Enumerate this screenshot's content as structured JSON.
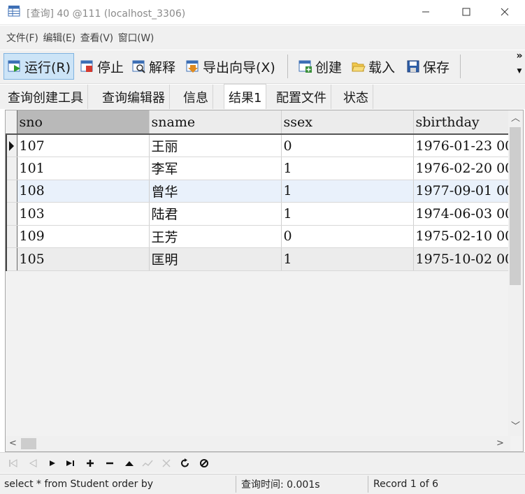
{
  "window": {
    "title": "[查询] 40 @111 (localhost_3306)",
    "icon": "db-table-icon"
  },
  "menu": [
    "文件(F)",
    "编辑(E)",
    "查看(V)",
    "窗口(W)"
  ],
  "toolbar": {
    "run": "运行(R)",
    "stop": "停止",
    "explain": "解释",
    "export": "导出向导(X)",
    "create": "创建",
    "load": "载入",
    "save": "保存",
    "overflow": "»"
  },
  "tabs": [
    "查询创建工具",
    "查询编辑器",
    "信息",
    "结果1",
    "配置文件",
    "状态"
  ],
  "active_tab_index": 3,
  "grid": {
    "columns": [
      "sno",
      "sname",
      "ssex",
      "sbirthday"
    ],
    "rows": [
      [
        "107",
        "王丽",
        "0",
        "1976-01-23 00"
      ],
      [
        "101",
        "李军",
        "1",
        "1976-02-20 00"
      ],
      [
        "108",
        "曾华",
        "1",
        "1977-09-01 00"
      ],
      [
        "103",
        "陆君",
        "1",
        "1974-06-03 00"
      ],
      [
        "109",
        "王芳",
        "0",
        "1975-02-10 00"
      ],
      [
        "105",
        "匡明",
        "1",
        "1975-10-02 00"
      ]
    ],
    "current_row_index": 0
  },
  "status": {
    "sql": "select * from Student order by",
    "query_time": "查询时间: 0.001s",
    "record": "Record 1 of 6"
  },
  "colors": {
    "active_button_bg": "#cce4f7",
    "sorted_header_bg": "#b9b9b9",
    "alt_row_bg": "#e9f1fb"
  }
}
